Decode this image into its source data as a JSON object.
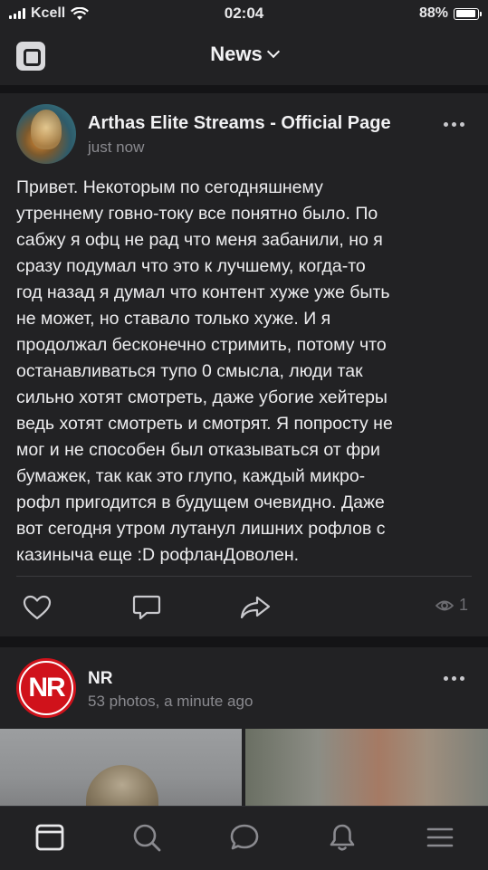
{
  "status_bar": {
    "carrier": "Kcell",
    "time": "02:04",
    "battery": "88%",
    "battery_level": 0.88
  },
  "header": {
    "title": "News"
  },
  "posts": [
    {
      "author": "Arthas Elite Streams - Official Page",
      "time": "just now",
      "lines": [
        "Привет. Некоторым по сегодняшнему",
        "утреннему говно-току все понятно было. По",
        "сабжу я офц не рад что меня забанили, но я",
        "сразу подумал что это к лучшему, когда-то",
        "год назад я думал что контент хуже уже быть",
        "не может, но ставало только хуже. И я",
        "продолжал бесконечно стримить, потому что",
        "останавливаться тупо 0 смысла, люди так",
        "сильно хотят смотреть, даже убогие хейтеры",
        "ведь хотят смотреть и смотрят. Я попросту не",
        "мог и не способен был отказываться от фри",
        "бумажек, так как это глупо, каждый микро-",
        "рофл пригодится в будущем очевидно. Даже",
        "вот сегодня утром лутанул лишних рофлов с",
        "казиныча еще :D рофланДоволен."
      ],
      "views": "1",
      "icons": [
        "heart-icon",
        "comment-icon",
        "share-icon",
        "eye-icon"
      ]
    },
    {
      "author": "NR",
      "avatar_text": "NR",
      "meta": "53 photos, a minute ago"
    }
  ],
  "tabbar": {
    "items": [
      "news-icon",
      "search-icon",
      "messages-icon",
      "notifications-icon",
      "menu-icon"
    ]
  },
  "colors": {
    "background": "#141416",
    "card": "#222224",
    "text": "#ededef",
    "muted": "#8a8a8f",
    "nr_red": "#d0121b"
  }
}
